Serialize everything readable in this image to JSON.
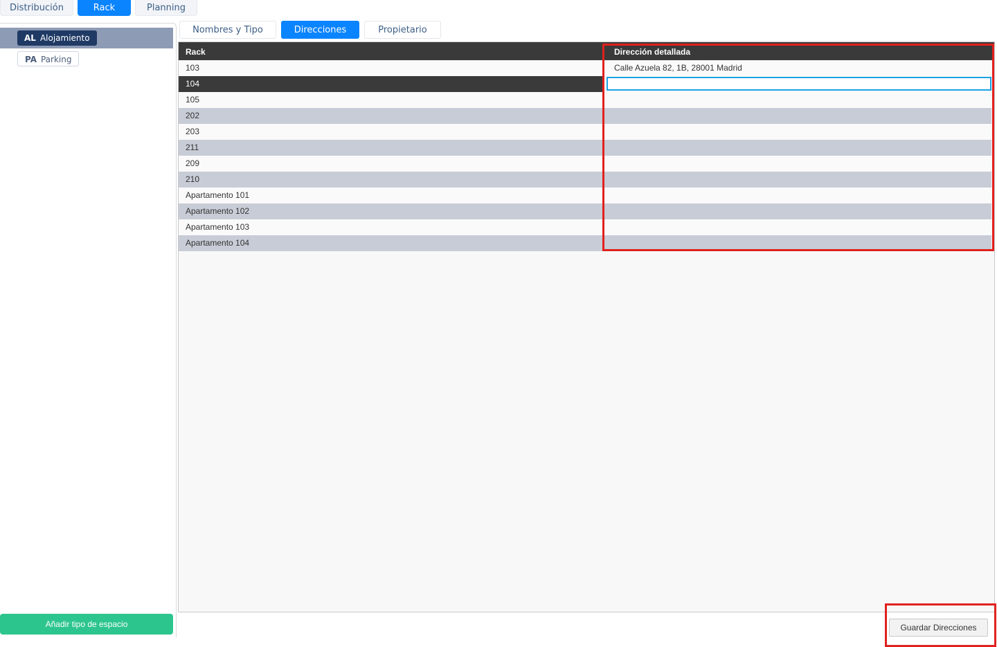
{
  "top_tabs": [
    "Distribución",
    "Rack",
    "Planning"
  ],
  "sidebar": {
    "items": [
      {
        "code": "AL",
        "label": "Alojamiento",
        "selected": true
      },
      {
        "code": "PA",
        "label": "Parking",
        "selected": false
      }
    ],
    "add_button": "Añadir tipo de espacio"
  },
  "sub_tabs": [
    "Nombres y Tipo",
    "Direcciones",
    "Propietario"
  ],
  "grid": {
    "columns": [
      "Rack",
      "Dirección detallada"
    ],
    "rows": [
      {
        "rack": "103",
        "address": "Calle Azuela 82, 1B, 28001 Madrid"
      },
      {
        "rack": "104",
        "address": ""
      },
      {
        "rack": "105",
        "address": ""
      },
      {
        "rack": "202",
        "address": ""
      },
      {
        "rack": "203",
        "address": ""
      },
      {
        "rack": "211",
        "address": ""
      },
      {
        "rack": "209",
        "address": ""
      },
      {
        "rack": "210",
        "address": ""
      },
      {
        "rack": "Apartamento 101",
        "address": ""
      },
      {
        "rack": "Apartamento 102",
        "address": ""
      },
      {
        "rack": "Apartamento 103",
        "address": ""
      },
      {
        "rack": "Apartamento 104",
        "address": ""
      }
    ]
  },
  "save_button": "Guardar Direcciones",
  "colors": {
    "accent": "#0a84ff",
    "add_button": "#2dc58e",
    "header": "#3a3a3a",
    "highlight": "#e0211e"
  }
}
